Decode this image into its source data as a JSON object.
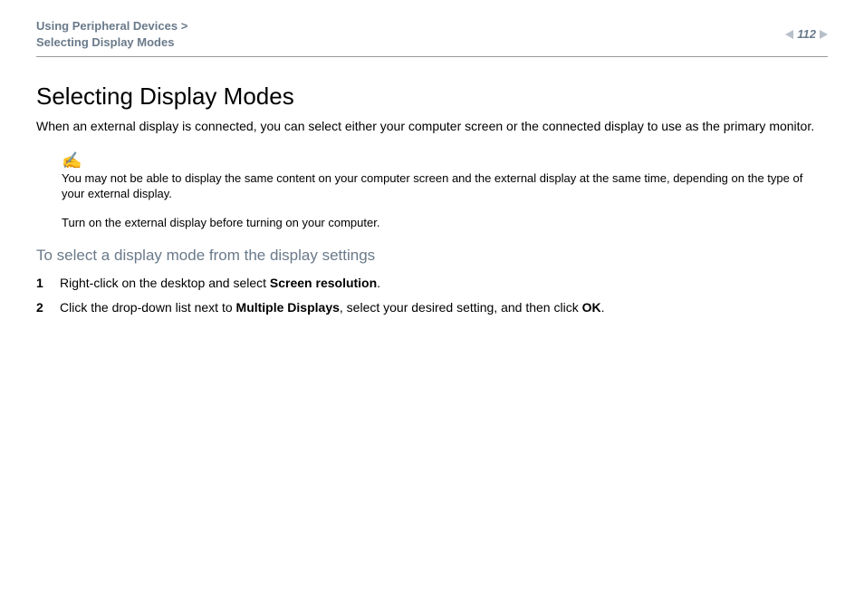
{
  "header": {
    "breadcrumb_section": "Using Peripheral Devices",
    "breadcrumb_sep": " >",
    "breadcrumb_page": "Selecting Display Modes",
    "page_number": "112"
  },
  "title": "Selecting Display Modes",
  "intro": "When an external display is connected, you can select either your computer screen or the connected display to use as the primary monitor.",
  "note": {
    "icon": "✍",
    "text1": "You may not be able to display the same content on your computer screen and the external display at the same time, depending on the type of your external display.",
    "text2": "Turn on the external display before turning on your computer."
  },
  "subhead": "To select a display mode from the display settings",
  "steps": [
    {
      "pre": "Right-click on the desktop and select ",
      "bold1": "Screen resolution",
      "post": "."
    },
    {
      "pre": "Click the drop-down list next to ",
      "bold1": "Multiple Displays",
      "mid": ", select your desired setting, and then click ",
      "bold2": "OK",
      "post": "."
    }
  ]
}
